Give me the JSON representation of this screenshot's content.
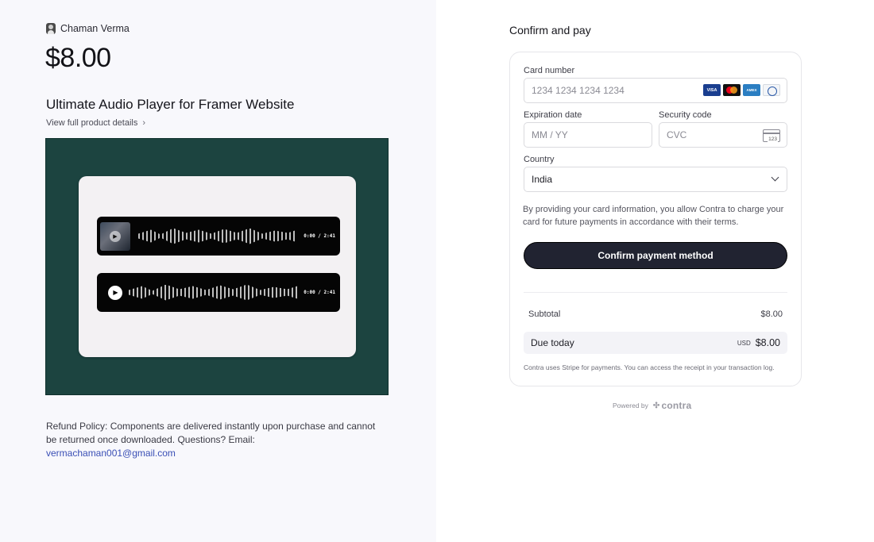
{
  "seller": {
    "name": "Chaman Verma"
  },
  "product": {
    "price": "$8.00",
    "title": "Ultimate Audio Player for Framer Website",
    "details_link": "View full product details",
    "preview": {
      "players": [
        {
          "time": "0:00 / 2:41",
          "has_thumbnail": true
        },
        {
          "time": "0:00 / 2:41",
          "has_thumbnail": false
        }
      ]
    }
  },
  "refund": {
    "text": "Refund Policy: Components are delivered instantly upon purchase and cannot be returned once downloaded. Questions? Email:",
    "email": "vermachaman001@gmail.com"
  },
  "checkout": {
    "title": "Confirm and pay",
    "card_number": {
      "label": "Card number",
      "placeholder": "1234 1234 1234 1234",
      "brands": [
        "VISA",
        "Mastercard",
        "AMEX",
        "Diners"
      ]
    },
    "expiration": {
      "label": "Expiration date",
      "placeholder": "MM / YY"
    },
    "security": {
      "label": "Security code",
      "placeholder": "CVC",
      "icon_text": "123"
    },
    "country": {
      "label": "Country",
      "value": "India"
    },
    "consent": "By providing your card information, you allow Contra to charge your card for future payments in accordance with their terms.",
    "confirm_button": "Confirm payment method",
    "subtotal": {
      "label": "Subtotal",
      "value": "$8.00"
    },
    "due_today": {
      "label": "Due today",
      "currency": "USD",
      "value": "$8.00"
    },
    "stripe_note": "Contra uses Stripe for payments. You can access the receipt in your transaction log.",
    "powered_by": "Powered by",
    "brand": "contra"
  },
  "colors": {
    "preview_bg": "#1c4440",
    "button_bg": "#212331",
    "link": "#3a4fb5"
  }
}
